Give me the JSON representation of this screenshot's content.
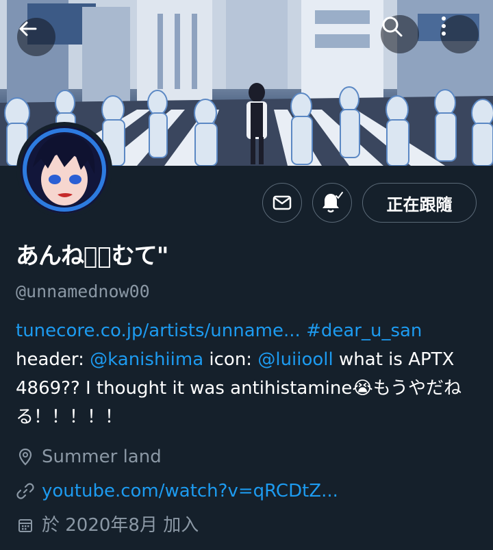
{
  "profile": {
    "display_name": "あんねᡃ⃝むて\"",
    "handle": "@unnamednow00",
    "follow_label": "正在跟隨",
    "bio": {
      "link_text": "tunecore.co.jp/artists/unname...",
      "hashtag": "#dear_u_san",
      "header_label": "header: ",
      "header_mention": "@kanishiima",
      "icon_label": " icon: ",
      "icon_mention": "@luiiooll",
      "text": " what is APTX 4869?? I thought it was antihistamine😭もうやだねる！！！！！"
    },
    "location": "Summer land",
    "website": "youtube.com/watch?v=qRCDtZ...",
    "joined": "於 2020年8月 加入"
  },
  "icons": {
    "back": "arrow-left-icon",
    "search": "search-icon",
    "more": "more-vertical-icon",
    "message": "envelope-icon",
    "notify": "bell-check-icon",
    "location": "location-pin-icon",
    "link": "link-icon",
    "calendar": "calendar-icon"
  },
  "colors": {
    "background": "#15202b",
    "accent": "#1d9bf0",
    "secondary_text": "#8b98a5",
    "border": "#5b6a78"
  }
}
